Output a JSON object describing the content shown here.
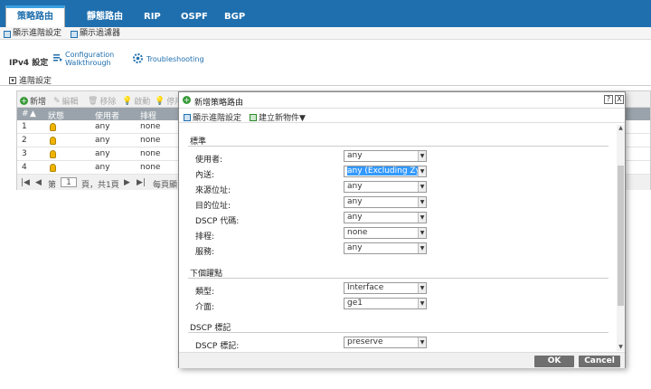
{
  "top_tabs": [
    "策略路由",
    "靜態路由",
    "RIP",
    "OSPF",
    "BGP"
  ],
  "subbar": {
    "advanced": "顯示進階設定",
    "filter": "顯示過濾器"
  },
  "toolbar": {
    "ipv4": "IPv4 設定",
    "config_walk_1": "Configuration",
    "config_walk_2": "Walkthrough",
    "troubleshooting": "Troubleshooting"
  },
  "advanced_label": "進階設定",
  "bg_table": {
    "tools": [
      "新增",
      "編輯",
      "移除",
      "啟動",
      "停用"
    ],
    "headers": [
      "#",
      "狀態",
      "使用者",
      "排程"
    ],
    "rows": [
      {
        "n": "1",
        "user": "any",
        "schedule": "none"
      },
      {
        "n": "2",
        "user": "any",
        "schedule": "none"
      },
      {
        "n": "3",
        "user": "any",
        "schedule": "none"
      },
      {
        "n": "4",
        "user": "any",
        "schedule": "none"
      }
    ],
    "pager": {
      "page_label": "第",
      "page": "1",
      "of": "頁，共1頁",
      "per_page": "每頁顯"
    }
  },
  "modal": {
    "title": "新增策略路由",
    "help": "?",
    "close": "X",
    "tools": {
      "advanced": "顯示進階設定",
      "create": "建立新物件▼"
    },
    "sections": {
      "criteria": "標準",
      "next_hop": "下個躍點",
      "dscp_mark": "DSCP 標記"
    },
    "fields": [
      {
        "label": "使用者:",
        "value": "any"
      },
      {
        "label": "內送:",
        "value": "any (Excluding ZyW"
      },
      {
        "label": "來源位址:",
        "value": "any"
      },
      {
        "label": "目的位址:",
        "value": "any"
      },
      {
        "label": "DSCP 代碼:",
        "value": "any"
      },
      {
        "label": "排程:",
        "value": "none"
      },
      {
        "label": "服務:",
        "value": "any"
      }
    ],
    "nexthop_fields": [
      {
        "label": "類型:",
        "value": "Interface"
      },
      {
        "label": "介面:",
        "value": "ge1"
      }
    ],
    "dscp_fields": [
      {
        "label": "DSCP 標記:",
        "value": "preserve"
      }
    ],
    "ok": "OK",
    "cancel": "Cancel"
  },
  "colors": {
    "topbar": "#1f6fae",
    "selected": "#3399ff",
    "button": "#6f6f6f"
  }
}
